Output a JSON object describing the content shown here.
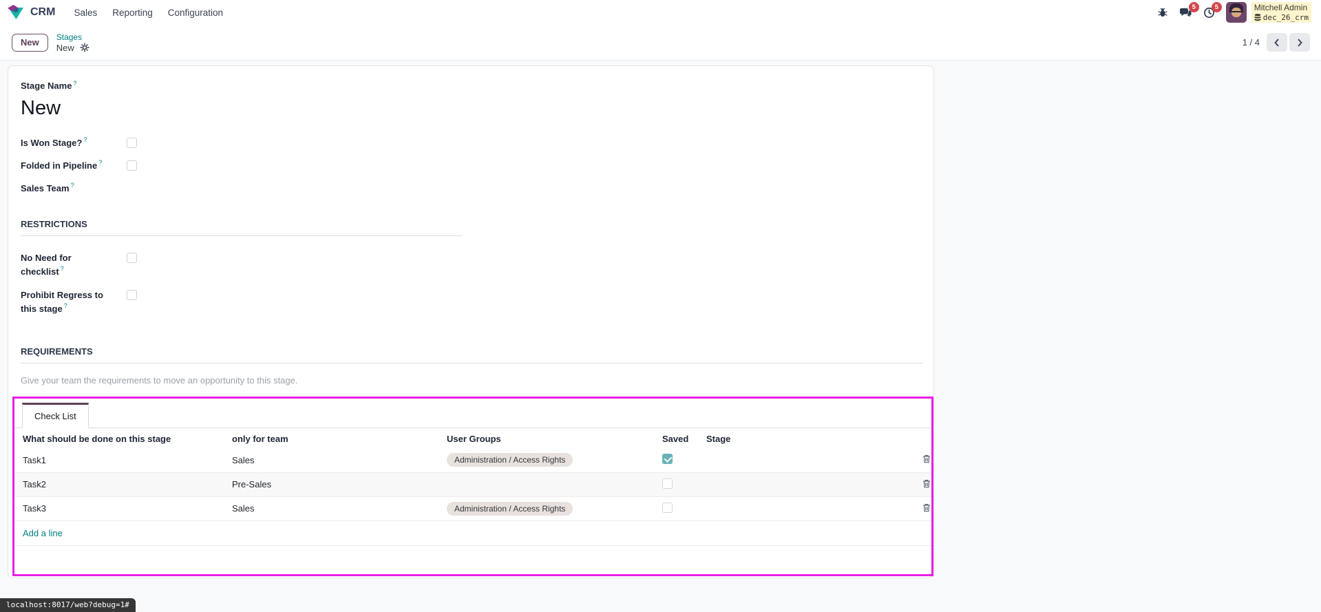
{
  "colors": {
    "accent_teal": "#017e84",
    "brand_purple": "#714B67",
    "highlight_magenta": "#e621e6",
    "badge_red": "#d5464d",
    "checked_checkbox": "#68b3b8"
  },
  "navbar": {
    "app_name": "CRM",
    "menus": [
      "Sales",
      "Reporting",
      "Configuration"
    ],
    "messages_badge": "5",
    "activities_badge": "5",
    "user": {
      "name": "Mitchell Admin",
      "database": "dec_26_crm"
    }
  },
  "control_panel": {
    "new_button_label": "New",
    "breadcrumb": {
      "parent": "Stages",
      "current": "New"
    },
    "pager": {
      "value": "1 / 4"
    }
  },
  "form": {
    "stage_name": {
      "label": "Stage Name",
      "help": "?",
      "value": "New"
    },
    "is_won": {
      "label": "Is Won Stage?",
      "help": "?"
    },
    "folded": {
      "label": "Folded in Pipeline",
      "help": "?"
    },
    "sales_team": {
      "label": "Sales Team",
      "help": "?"
    },
    "restrictions": {
      "title": "RESTRICTIONS",
      "no_need": {
        "label": "No Need for checklist",
        "help": "?"
      },
      "prohibit": {
        "label": "Prohibit Regress to this stage",
        "help": "?"
      }
    },
    "requirements": {
      "title": "REQUIREMENTS",
      "placeholder": "Give your team the requirements to move an opportunity to this stage."
    }
  },
  "checklist": {
    "tab_label": "Check List",
    "columns": [
      "What should be done on this stage",
      "only for team",
      "User Groups",
      "Saved",
      "Stage"
    ],
    "rows": [
      {
        "task": "Task1",
        "team": "Sales",
        "groups": "Administration / Access Rights",
        "saved": true,
        "stage": ""
      },
      {
        "task": "Task2",
        "team": "Pre-Sales",
        "groups": "",
        "saved": false,
        "stage": ""
      },
      {
        "task": "Task3",
        "team": "Sales",
        "groups": "Administration / Access Rights",
        "saved": false,
        "stage": ""
      }
    ],
    "add_line_label": "Add a line"
  },
  "status_bar": {
    "url": "localhost:8017/web?debug=1#"
  }
}
